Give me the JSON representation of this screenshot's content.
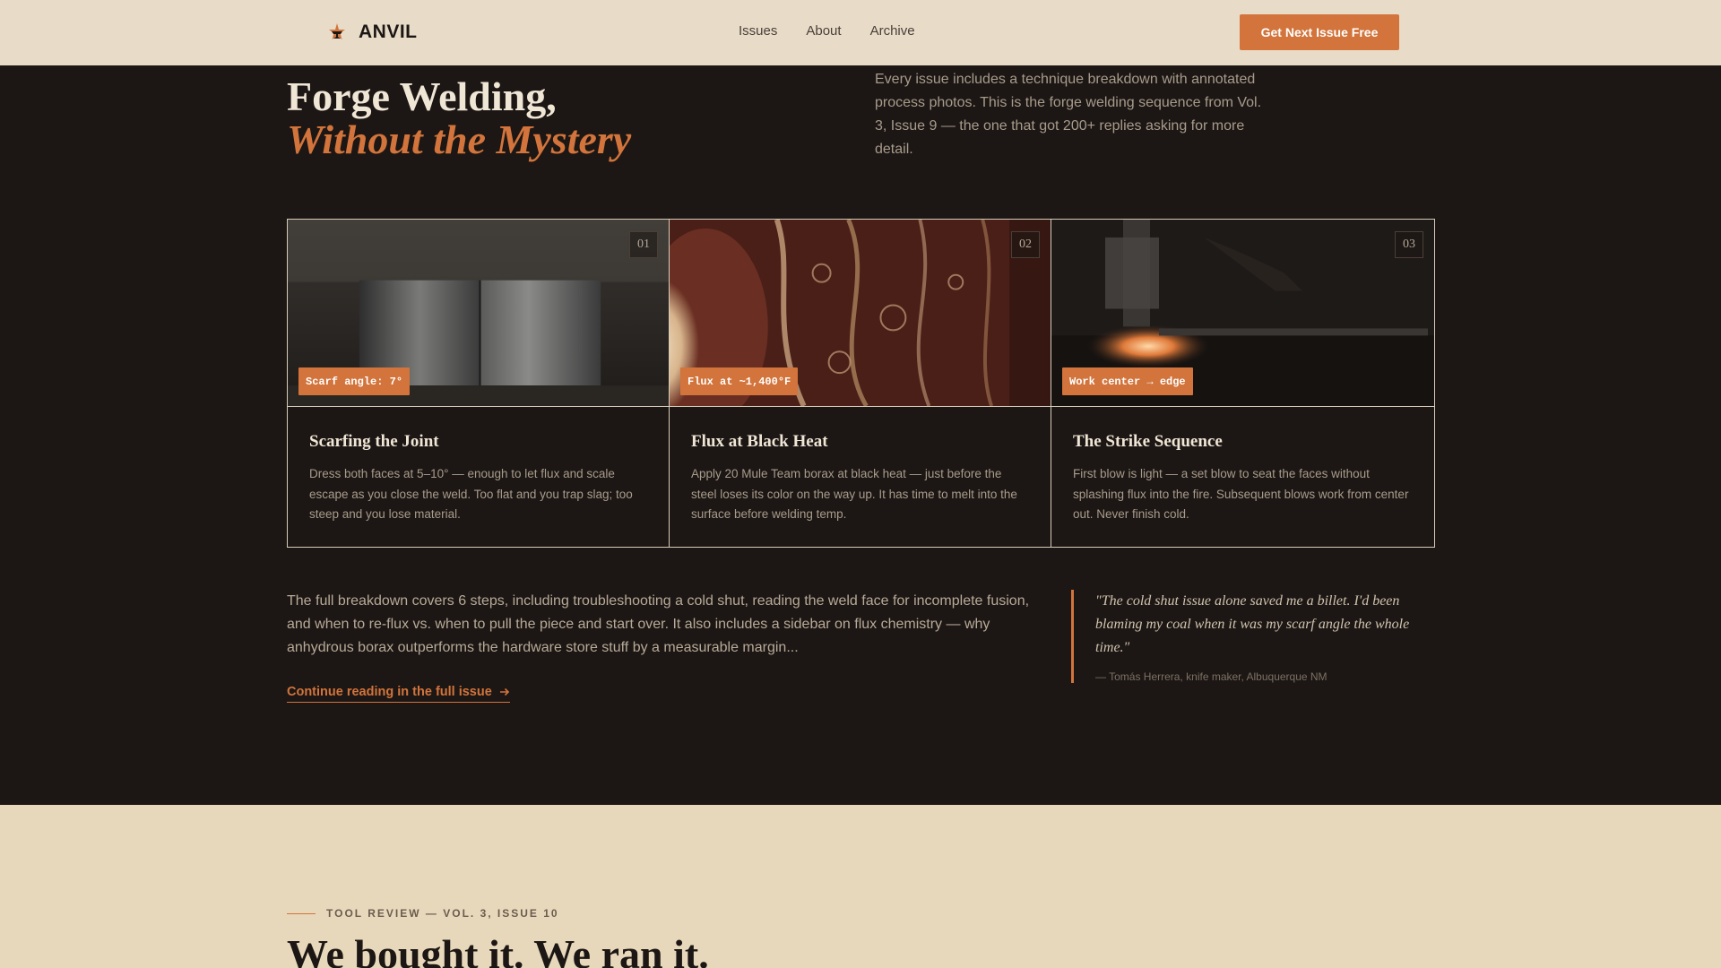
{
  "nav": {
    "brand": "ANVIL",
    "links": [
      "Issues",
      "About",
      "Archive"
    ],
    "cta": "Get Next Issue Free"
  },
  "hero": {
    "title_line1": "Forge Welding,",
    "title_line2": "Without the Mystery",
    "description": "Every issue includes a technique breakdown with annotated process photos. This is the forge welding sequence from Vol. 3, Issue 9 — the one that got 200+ replies asking for more detail."
  },
  "cards": [
    {
      "number": "01",
      "tag": "Scarf angle: 7°",
      "title": "Scarfing the Joint",
      "text": "Dress both faces at 5–10° — enough to let flux and scale escape as you close the weld. Too flat and you trap slag; too steep and you lose material."
    },
    {
      "number": "02",
      "tag": "Flux at ~1,400°F",
      "title": "Flux at Black Heat",
      "text": "Apply 20 Mule Team borax at black heat — just before the steel loses its color on the way up. It has time to melt into the surface before welding temp."
    },
    {
      "number": "03",
      "tag": "Work center → edge",
      "title": "The Strike Sequence",
      "text": "First blow is light — a set blow to seat the faces without splashing flux into the fire. Subsequent blows work from center out. Never finish cold."
    }
  ],
  "summary": "The full breakdown covers 6 steps, including troubleshooting a cold shut, reading the weld face for incomplete fusion, and when to re-flux vs. when to pull the piece and start over. It also includes a sidebar on flux chemistry — why anhydrous borax outperforms the hardware store stuff by a measurable margin...",
  "read_more": "Continue reading in the full issue",
  "quote": {
    "text": "\"The cold shut issue alone saved me a billet. I'd been blaming my coal when it was my scarf angle the whole time.\"",
    "cite": "— Tomás Herrera, knife maker, Albuquerque NM"
  },
  "next_section": {
    "eyebrow": "TOOL REVIEW — VOL. 3, ISSUE 10",
    "title": "We bought it. We ran it."
  },
  "colors": {
    "accent": "#d2743c",
    "dark_bg": "#1c1714",
    "nav_bg": "#e8dcc8",
    "light_section_bg": "#e8d8bb"
  }
}
